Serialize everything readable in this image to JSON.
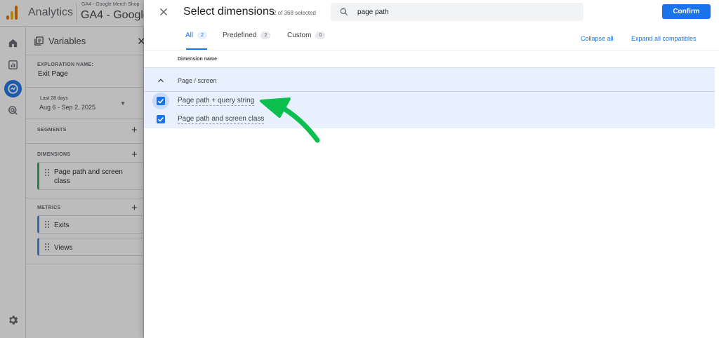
{
  "header": {
    "product": "Analytics",
    "account_small": "GA4 - Google Merch Shop",
    "account_big": "GA4 - Google"
  },
  "rail": {
    "icons": [
      "home-icon",
      "reports-icon",
      "explore-icon",
      "advertising-icon"
    ],
    "settings_icon": "settings-gear-icon"
  },
  "variables": {
    "title": "Variables",
    "exploration_label": "EXPLORATION NAME:",
    "exploration_name": "Exit Page",
    "date_label": "Last 28 days",
    "date_range": "Aug 6 - Sep 2, 2025",
    "segments_label": "SEGMENTS",
    "dimensions_label": "DIMENSIONS",
    "dimensions": [
      "Page path and screen class"
    ],
    "metrics_label": "METRICS",
    "metrics": [
      "Exits",
      "Views"
    ]
  },
  "dialog": {
    "title": "Select dimensions",
    "selected_count": "2 of 368 selected",
    "search_value": "page path",
    "search_placeholder": "Search",
    "confirm_label": "Confirm",
    "tabs": [
      {
        "label": "All",
        "count": "2",
        "active": true
      },
      {
        "label": "Predefined",
        "count": "2",
        "active": false
      },
      {
        "label": "Custom",
        "count": "0",
        "active": false
      }
    ],
    "collapse_all": "Collapse all",
    "expand_all": "Expand all compatibles",
    "column_header": "Dimension name",
    "group": "Page / screen",
    "items": [
      {
        "label": "Page path + query string",
        "checked": true
      },
      {
        "label": "Page path and screen class",
        "checked": true
      }
    ]
  },
  "colors": {
    "accent": "#1a73e8",
    "row_highlight": "#e8f0fe",
    "annotation_arrow": "#0bbf4f"
  }
}
